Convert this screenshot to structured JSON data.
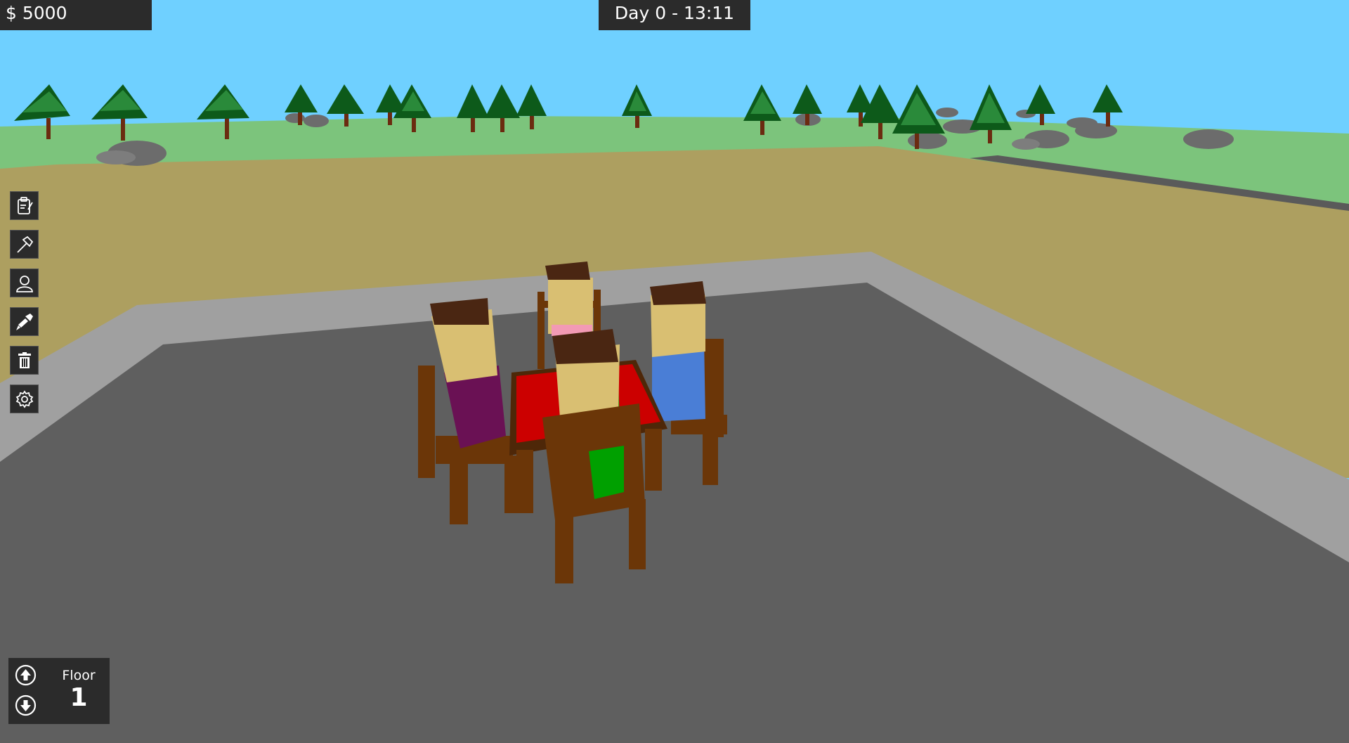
{
  "hud": {
    "money": "$ 5000",
    "clock": "Day 0 - 13:11"
  },
  "toolbar": {
    "items": [
      {
        "name": "clipboard-icon",
        "tool": "tasks"
      },
      {
        "name": "hammer-icon",
        "tool": "build"
      },
      {
        "name": "person-icon",
        "tool": "staff"
      },
      {
        "name": "paint-brush-icon",
        "tool": "decorate"
      },
      {
        "name": "trash-icon",
        "tool": "delete"
      },
      {
        "name": "gear-icon",
        "tool": "settings"
      }
    ]
  },
  "floor": {
    "label": "Floor",
    "number": "1"
  },
  "colors": {
    "sky": "#6fd0ff",
    "grass": "#7cc47c",
    "dirt": "#ad9f60",
    "floor": "#5f5f5f",
    "wall": "#a0a0a0",
    "table_top": "#cc0000",
    "wood": "#5e3306",
    "hud_bg": "#2b2b2b"
  }
}
